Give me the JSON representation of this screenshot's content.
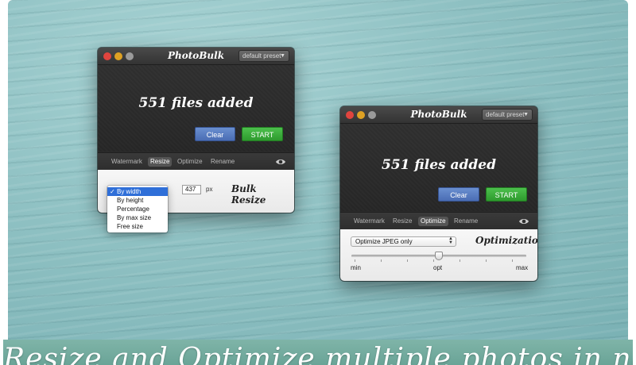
{
  "app": {
    "title": "PhotoBulk",
    "preset_label": "default preset"
  },
  "status": {
    "files_added": "551 files added"
  },
  "buttons": {
    "clear": "Clear",
    "start": "START"
  },
  "tabs": {
    "watermark": "Watermark",
    "resize": "Resize",
    "optimize": "Optimize",
    "rename": "Rename"
  },
  "resize_panel": {
    "heading": "Bulk Resize",
    "width_value": "437",
    "unit": "px",
    "mode_options": [
      "By width",
      "By height",
      "Percentage",
      "By max size",
      "Free size"
    ],
    "selected_mode": "By width"
  },
  "optimize_panel": {
    "heading": "Optimization",
    "format_select": "Optimize JPEG only",
    "quality_slider": {
      "labels": {
        "min": "min",
        "opt": "opt",
        "max": "max"
      },
      "level": 0.5
    }
  },
  "banner": {
    "text": "Resize and Optimize multiple photos in no time."
  },
  "colors": {
    "clear_button": "#4a6db4",
    "start_button": "#2e9a2e",
    "menu_selection": "#2f6fd8",
    "banner": "#6aa497"
  },
  "icons": {
    "preset_arrow": "dropdown-arrow-icon",
    "preview": "eye-icon",
    "checkmark": "check-icon"
  }
}
